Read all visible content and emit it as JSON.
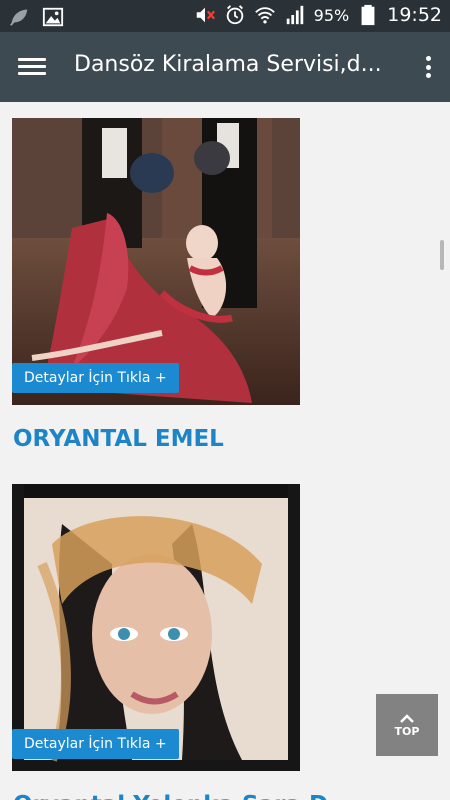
{
  "status_bar": {
    "battery": "95%",
    "time": "19:52"
  },
  "app_bar": {
    "title": "Dansöz Kiralama Servisi,d..."
  },
  "cards": [
    {
      "button_label": "Detaylar İçin Tıkla +",
      "title": "ORYANTAL EMEL"
    },
    {
      "button_label": "Detaylar İçin Tıkla +",
      "title": "Oryantal Yelenka Sara D..."
    }
  ],
  "top_button": {
    "label": "TOP"
  },
  "colors": {
    "accent": "#1c8ad1",
    "title_blue": "#1c84c7",
    "app_bar": "#3d4a52",
    "status_bar": "#2b3237"
  }
}
